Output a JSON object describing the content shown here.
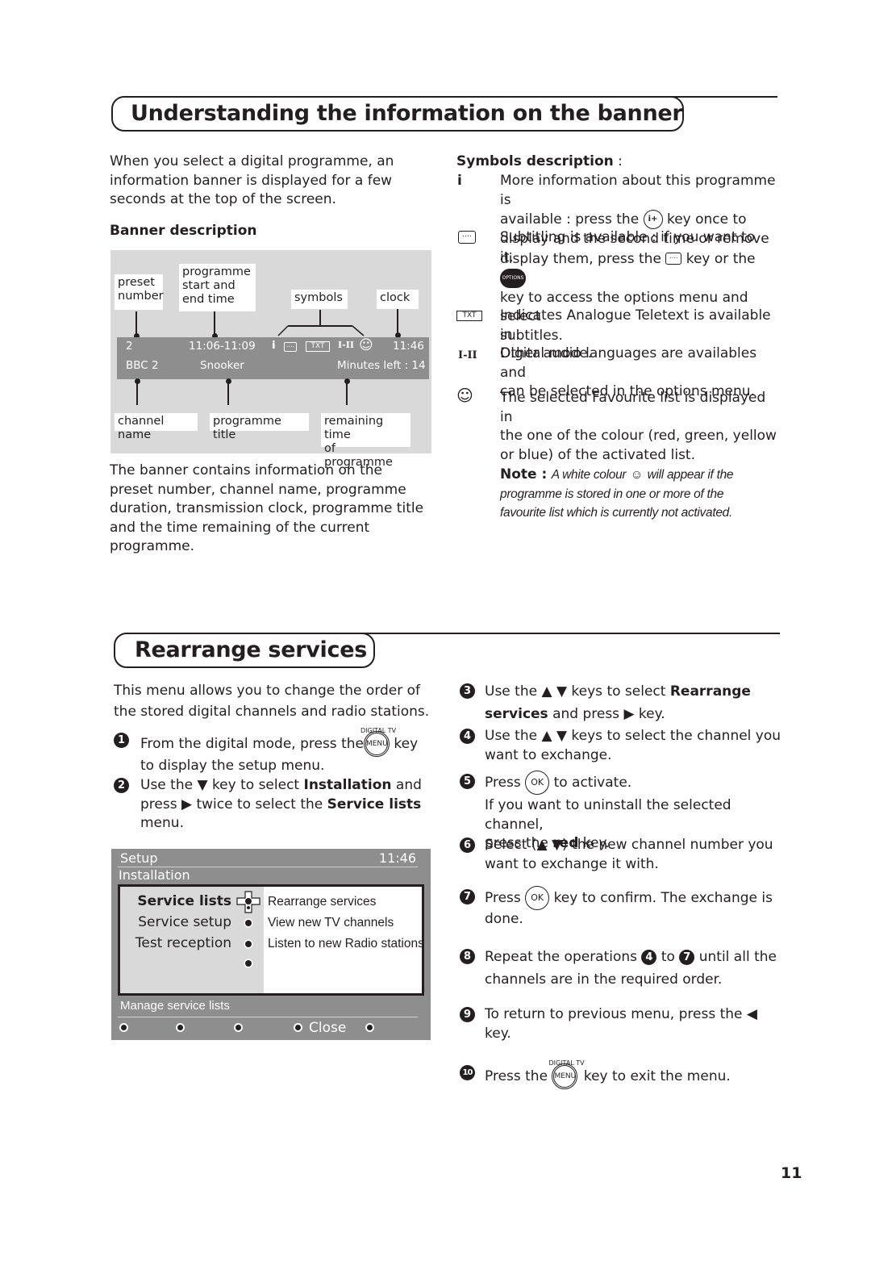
{
  "section1": {
    "title": "Understanding the information on the banner",
    "intro": [
      "When you select a digital programme, an",
      "information banner is displayed for a few",
      "seconds at the top of the screen."
    ],
    "banner_heading": "Banner description",
    "figure": {
      "labels": {
        "preset_number": [
          "preset",
          "number"
        ],
        "start_end": [
          "programme",
          "start and",
          "end time"
        ],
        "symbols": "symbols",
        "clock": "clock",
        "channel_name": "channel name",
        "programme_title": "programme title",
        "remaining": [
          "remaining time",
          "of programme"
        ]
      },
      "banner": {
        "preset": "2",
        "time_range": "11:06-11:09",
        "info_symbol": "i",
        "txt_symbol": "TXT",
        "audio_symbol": "I-II",
        "clock": "11:46",
        "channel": "BBC 2",
        "programme": "Snooker",
        "minutes_left": "Minutes left : 14"
      }
    },
    "summary": [
      "The banner contains information on the",
      "preset number, channel name, programme",
      "duration, transmission clock, programme title",
      "and the time remaining of the current",
      "programme."
    ],
    "symbols_heading": "Symbols description",
    "symbols_colon": " :",
    "symbols": [
      {
        "icon": "i",
        "lines": [
          "More information about this programme is",
          "available : press the",
          "key once to",
          "display and the second time or remove it."
        ],
        "key": "i+"
      },
      {
        "icon": "subtitle-icon",
        "lines": [
          "Subtitling is available : if you want to",
          "display them, press the",
          "key or the",
          "key to access the options menu and select",
          "subtitles."
        ],
        "key": "OPTIONS"
      },
      {
        "icon": "TXT",
        "lines": [
          "Indicates Analogue Teletext is available in",
          "Digital mode."
        ]
      },
      {
        "icon": "I-II",
        "lines": [
          "Other audio languages are availables and",
          "can be selected in the options menu."
        ]
      },
      {
        "icon": "smiley-icon",
        "lines": [
          "The selected Favourite list is displayed in",
          "the one of the colour (red, green, yellow",
          "or blue) of the activated list."
        ]
      }
    ],
    "note": {
      "label": "Note :",
      "lines": [
        "A white colour",
        "will appear if the",
        "programme is stored in one or more of the",
        "favourite list which is currently not activated."
      ]
    }
  },
  "section2": {
    "title": "Rearrange services",
    "intro": [
      "This menu allows you to change the order of",
      "the stored digital channels and radio stations."
    ],
    "digital_tv_label": "DIGITAL TV",
    "menu_key": "MENU",
    "ok_key": "OK",
    "steps": [
      {
        "n": "1",
        "parts": [
          "From the digital mode, press the",
          "key",
          "to display the setup menu."
        ]
      },
      {
        "n": "2",
        "parts": [
          "Use the ▼ key to select ",
          "Installation",
          " and",
          "press ▶ twice to select the ",
          "Service lists",
          "menu."
        ]
      },
      {
        "n": "3",
        "parts": [
          "Use the ▲ ▼ keys to select ",
          "Rearrange",
          "services",
          " and press ▶ key."
        ]
      },
      {
        "n": "4",
        "parts": [
          "Use the ▲ ▼ keys to select the channel you",
          "want to exchange."
        ]
      },
      {
        "n": "5",
        "parts": [
          "Press",
          "to activate.",
          "If you want to uninstall the selected channel,",
          "press the ",
          "red",
          " key."
        ]
      },
      {
        "n": "6",
        "parts": [
          "Select (▲ ▼) the new channel number you",
          "want to exchange it with."
        ]
      },
      {
        "n": "7",
        "parts": [
          "Press",
          "key to confirm. The exchange is",
          "done."
        ]
      },
      {
        "n": "8",
        "parts": [
          "Repeat the operations",
          "4",
          "to",
          "7",
          "until all the",
          "channels are in the required order."
        ]
      },
      {
        "n": "9",
        "parts": [
          "To return to previous menu, press the ◀",
          "key."
        ]
      },
      {
        "n": "10",
        "parts": [
          "Press the",
          "key to exit the menu."
        ]
      }
    ],
    "setup_menu": {
      "title": "Setup",
      "clock": "11:46",
      "subtitle": "Installation",
      "items": [
        "Service lists",
        "Service setup",
        "Test reception"
      ],
      "sub_items": [
        "Rearrange services",
        "View new TV channels",
        "Listen to new Radio stations"
      ],
      "status": "Manage service lists",
      "footer_close": "Close"
    }
  },
  "page_number": "11"
}
